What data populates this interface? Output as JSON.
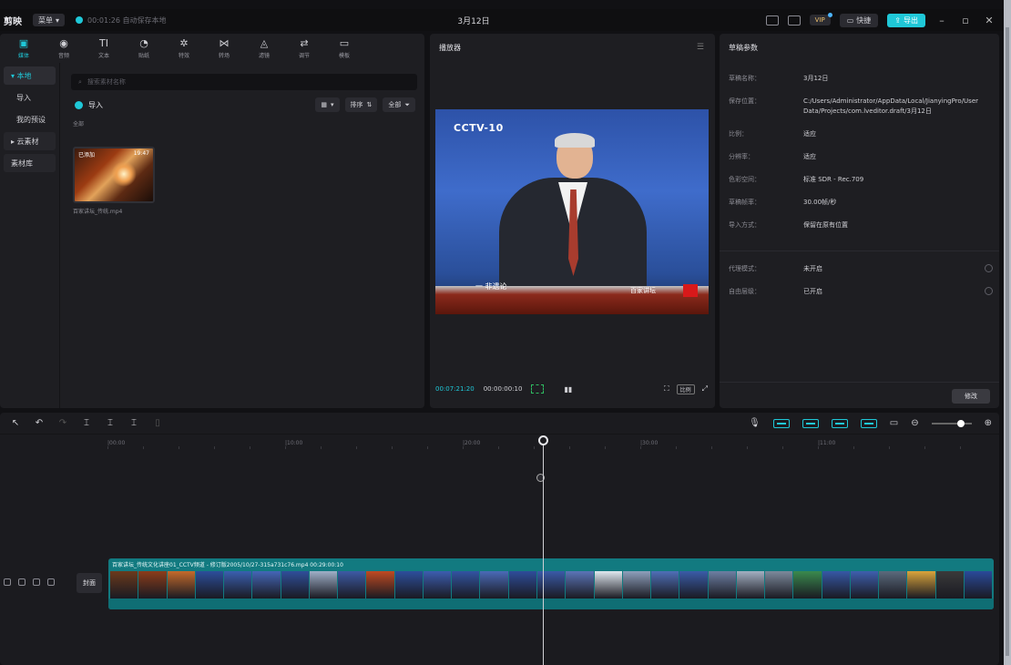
{
  "titlebar": {
    "app_name": "剪映",
    "menu_label": "菜单",
    "autosave_text": "00:01:26 自动保存本地",
    "window_title": "3月12日",
    "pro_label": "VIP",
    "shortcut_label": "快捷",
    "export_label": "导出"
  },
  "toolbar": {
    "tools": [
      {
        "glyph": "▣",
        "label": "媒体",
        "active": true
      },
      {
        "glyph": "◉",
        "label": "音频",
        "active": false
      },
      {
        "glyph": "TI",
        "label": "文本",
        "active": false
      },
      {
        "glyph": "◔",
        "label": "贴纸",
        "active": false
      },
      {
        "glyph": "✲",
        "label": "特效",
        "active": false
      },
      {
        "glyph": "⋈",
        "label": "转场",
        "active": false
      },
      {
        "glyph": "◬",
        "label": "滤镜",
        "active": false
      },
      {
        "glyph": "⇄",
        "label": "调节",
        "active": false
      },
      {
        "glyph": "▭",
        "label": "模板",
        "active": false
      }
    ]
  },
  "media_sidebar": {
    "local": "▾ 本地",
    "import": "导入",
    "my_presets": "我的预设",
    "cloud": "▸ 云素材",
    "library": "素材库"
  },
  "media": {
    "search_placeholder": "搜索素材名称",
    "import_label": "导入",
    "view_label": "▾",
    "sort_label": "排序",
    "filter_label": "全部",
    "section_label": "全部",
    "thumb_name": "已添加",
    "thumb_duration": "19:47",
    "thumb_caption": "百家讲坛_传统.mp4"
  },
  "player": {
    "title": "播放器",
    "current_time": "00:07:21:20",
    "total_time": "00:00:00:10",
    "ratio_label": "比例",
    "cctv_logo": "CCTV-10",
    "banner_text": "一 非遗论",
    "banner_right": "百家讲坛"
  },
  "draft_info": {
    "title": "草稿参数",
    "rows": [
      {
        "key": "草稿名称：",
        "value": "3月12日"
      },
      {
        "key": "保存位置：",
        "value": "C:/Users/Administrator/AppData/Local/JianyingPro/User Data/Projects/com.lveditor.draft/3月12日"
      },
      {
        "key": "比例：",
        "value": "适应"
      },
      {
        "key": "分辨率：",
        "value": "适应"
      },
      {
        "key": "色彩空间：",
        "value": "标准 SDR - Rec.709"
      },
      {
        "key": "草稿帧率：",
        "value": "30.00帧/秒"
      },
      {
        "key": "导入方式：",
        "value": "保留在原有位置"
      }
    ],
    "rows2": [
      {
        "key": "代理模式：",
        "value": "未开启"
      },
      {
        "key": "自由层级：",
        "value": "已开启"
      }
    ],
    "edit_label": "修改"
  },
  "timeline": {
    "ruler_ticks": [
      "|00:00",
      "|10:00",
      "|20:00",
      "|30:00",
      "|11:00"
    ],
    "cover_label": "封面",
    "clip_label": "百家讲坛_传统文化讲座01_CCTV频道 - 修订版2005/10/27-315a731c76.mp4  00:29:00:10"
  }
}
